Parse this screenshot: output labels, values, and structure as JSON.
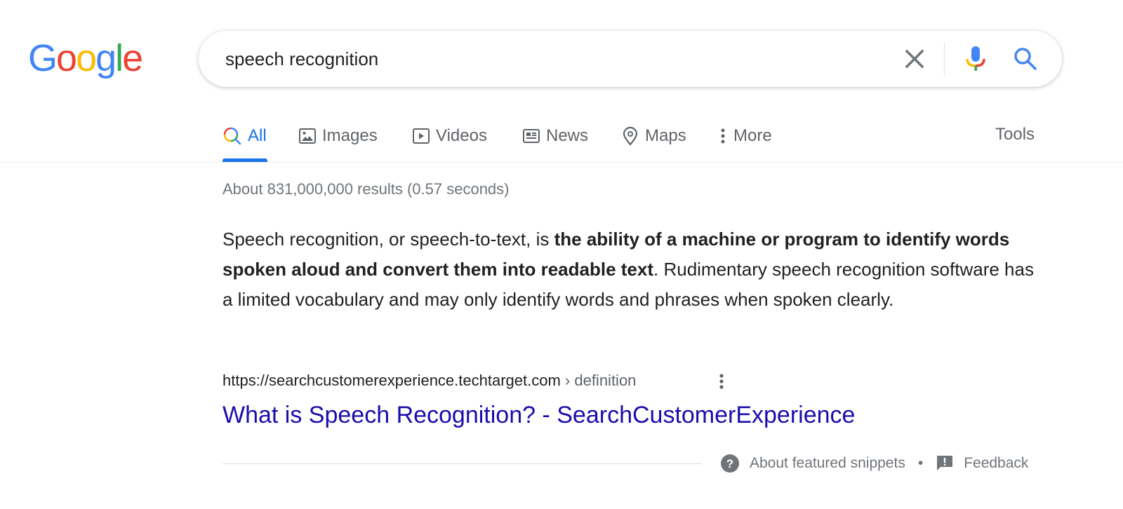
{
  "logo": {
    "letters": [
      "G",
      "o",
      "o",
      "g",
      "l",
      "e"
    ],
    "colors": [
      "#4285f4",
      "#ea4335",
      "#fbbc05",
      "#4285f4",
      "#34a853",
      "#ea4335"
    ]
  },
  "search": {
    "query": "speech recognition",
    "clear_icon": "close-icon",
    "voice_icon": "microphone-icon",
    "submit_icon": "search-icon"
  },
  "tabs": [
    {
      "label": "All",
      "icon": "search-icon",
      "active": true
    },
    {
      "label": "Images",
      "icon": "image-icon"
    },
    {
      "label": "Videos",
      "icon": "play-icon"
    },
    {
      "label": "News",
      "icon": "newspaper-icon"
    },
    {
      "label": "Maps",
      "icon": "map-pin-icon"
    },
    {
      "label": "More",
      "icon": "more-vert-icon"
    }
  ],
  "tools_label": "Tools",
  "result_stats": "About 831,000,000 results (0.57 seconds)",
  "snippet": {
    "prefix": "Speech recognition, or speech-to-text, is ",
    "bold": "the ability of a machine or program to identify words spoken aloud and convert them into readable text",
    "suffix": ". Rudimentary speech recognition software has a limited vocabulary and may only identify words and phrases when spoken clearly."
  },
  "source": {
    "url": "https://searchcustomerexperience.techtarget.com",
    "breadcrumb": " › definition",
    "title": "What is Speech Recognition? - SearchCustomerExperience"
  },
  "colors": {
    "accent": "#1a73e8",
    "link": "#1a0dab",
    "muted": "#70757a"
  },
  "footer": {
    "about_label": "About featured snippets",
    "separator": "•",
    "feedback_label": "Feedback"
  }
}
